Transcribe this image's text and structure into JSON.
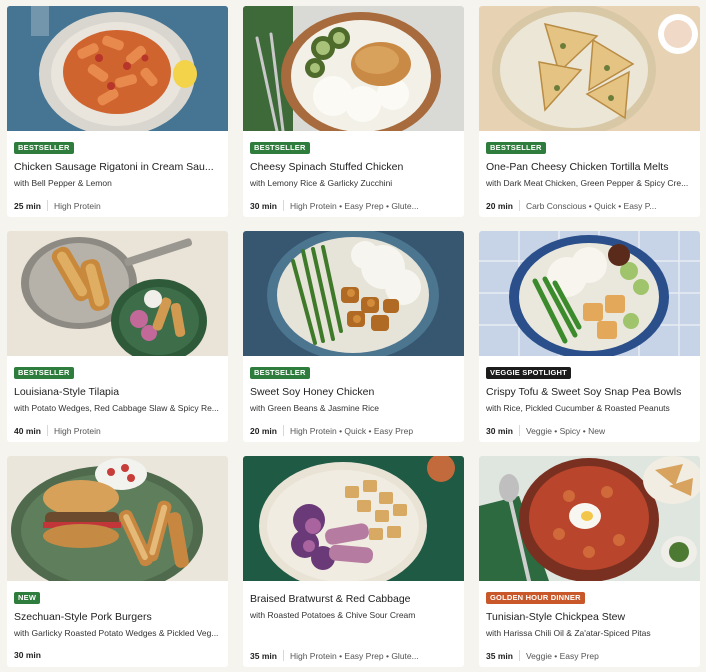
{
  "colors": {
    "bestseller": "#2f7d3c",
    "veggie_spotlight": "#1c1c1c",
    "new": "#2f7d3c",
    "golden_hour": "#c8582a"
  },
  "recipes": [
    {
      "badge": "BESTSELLER",
      "title": "Chicken Sausage Rigatoni in Cream Sau...",
      "subtitle": "with Bell Pepper & Lemon",
      "time": "25 min",
      "tags": "High Protein"
    },
    {
      "badge": "BESTSELLER",
      "title": "Cheesy Spinach Stuffed Chicken",
      "subtitle": "with Lemony Rice & Garlicky Zucchini",
      "time": "30 min",
      "tags": "High Protein • Easy Prep • Glute..."
    },
    {
      "badge": "BESTSELLER",
      "title": "One-Pan Cheesy Chicken Tortilla Melts",
      "subtitle": "with Dark Meat Chicken, Green Pepper & Spicy Cre...",
      "time": "20 min",
      "tags": "Carb Conscious • Quick • Easy P..."
    },
    {
      "badge": "BESTSELLER",
      "title": "Louisiana-Style Tilapia",
      "subtitle": "with Potato Wedges, Red Cabbage Slaw & Spicy Re...",
      "time": "40 min",
      "tags": "High Protein"
    },
    {
      "badge": "BESTSELLER",
      "title": "Sweet Soy Honey Chicken",
      "subtitle": "with Green Beans & Jasmine Rice",
      "time": "20 min",
      "tags": "High Protein • Quick • Easy Prep"
    },
    {
      "badge": "VEGGIE SPOTLIGHT",
      "title": "Crispy Tofu & Sweet Soy Snap Pea Bowls",
      "subtitle": "with Rice, Pickled Cucumber & Roasted Peanuts",
      "time": "30 min",
      "tags": "Veggie • Spicy • New"
    },
    {
      "badge": "NEW",
      "title": "Szechuan-Style Pork Burgers",
      "subtitle": "with Garlicky Roasted Potato Wedges & Pickled Veg...",
      "time": "30 min",
      "tags": ""
    },
    {
      "badge": "",
      "title": "Braised Bratwurst & Red Cabbage",
      "subtitle": "with Roasted Potatoes & Chive Sour Cream",
      "time": "35 min",
      "tags": "High Protein • Easy Prep • Glute..."
    },
    {
      "badge": "GOLDEN HOUR DINNER",
      "title": "Tunisian-Style Chickpea Stew",
      "subtitle": "with Harissa Chili Oil & Za'atar-Spiced Pitas",
      "time": "35 min",
      "tags": "Veggie • Easy Prep"
    }
  ]
}
